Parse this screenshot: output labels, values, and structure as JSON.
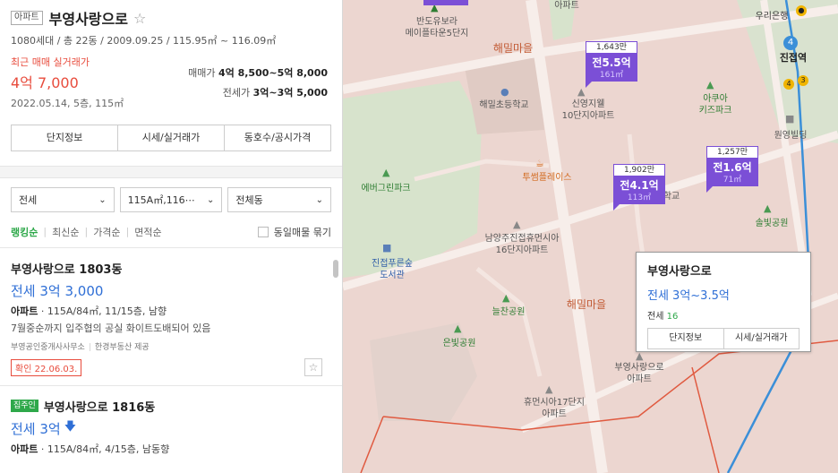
{
  "complex": {
    "type_tag": "아파트",
    "name": "부영사랑으로",
    "star": "☆",
    "info": "1080세대 / 총 22동 / 2009.09.25 / 115.95㎡ ~ 116.09㎡",
    "recent_label": "최근 매매 실거래가",
    "recent_price": "4억 7,000",
    "recent_date": "2022.05.14, 5층, 115㎡",
    "sale_label": "매매가",
    "sale_range": "4억 8,500~5억 8,000",
    "jeonse_label": "전세가",
    "jeonse_range": "3억~3억 5,000",
    "tabs": [
      "단지정보",
      "시세/실거래가",
      "동호수/공시가격"
    ]
  },
  "filters": [
    "전세",
    "115A㎡,116⋯",
    "전체동"
  ],
  "sorts": [
    "랭킹순",
    "최신순",
    "가격순",
    "면적순"
  ],
  "group_label": "동일매물 묶기",
  "listings": [
    {
      "name": "부영사랑으로 1803동",
      "price": "전세 3억 3,000",
      "spec_type": "아파트",
      "spec_detail": "115A/84㎡, 11/15층, 남향",
      "desc": "7월중순까지 입주협의 공실 화이트도배되어 있음",
      "agent": "부영공인중개사사무소",
      "provider": "한경부동산 제공",
      "confirm": "확인 22.06.03.",
      "fav": "☆"
    },
    {
      "owner_tag": "집주인",
      "name": "부영사랑으로 1816동",
      "price": "전세 3억",
      "down": "🡇",
      "spec_type": "아파트",
      "spec_detail": "115A/84㎡, 4/15층, 남동향"
    }
  ],
  "map": {
    "labels": {
      "banjeon": "반도유보라\n메이플타운5단지",
      "haemil_top": "해밀마을",
      "haemil_school": "해밀초등학교",
      "sinyoung": "신영지웰\n10단지아파트",
      "everygreen": "에버그린파크",
      "twosome": "투썸플레이스",
      "namyang": "남양주진접휴먼시아\n16단지아파트",
      "library": "진접푸른숲\n도서관",
      "neulchan": "늘찬공원",
      "haemil_mid": "해밀마을",
      "eunbit": "은빛공원",
      "buyoung_map": "부영사랑으로\n아파트",
      "humansia17": "휴먼시아17단지\n아파트",
      "aqua": "아쿠아\n키즈파크",
      "wonyoung": "원영빌딩",
      "solbit": "솔빛공원",
      "jinjeop": "진접역",
      "woori": "우리은행",
      "apt_top": "아파트",
      "hak": "학교"
    },
    "markers": [
      {
        "count": "1,643만",
        "price": "전5.5억",
        "area": "161㎡"
      },
      {
        "count": "1,902만",
        "price": "전4.1억",
        "area": "113㎡"
      },
      {
        "count": "1,257만",
        "price": "전1.6억",
        "area": "71㎡"
      }
    ],
    "popup": {
      "name": "부영사랑으로",
      "range": "전세 3억~3.5억",
      "count_label": "전세",
      "count": "16",
      "buttons": [
        "단지정보",
        "시세/실거래가"
      ]
    },
    "station_numbers": {
      "n4": "4",
      "n3": "3"
    }
  },
  "colors": {
    "accent_red": "#e84c3d",
    "price_blue": "#2f6fd6",
    "green": "#2ea84a",
    "marker_purple": "#7b4fd6",
    "map_bg": "#ecd6d0"
  }
}
